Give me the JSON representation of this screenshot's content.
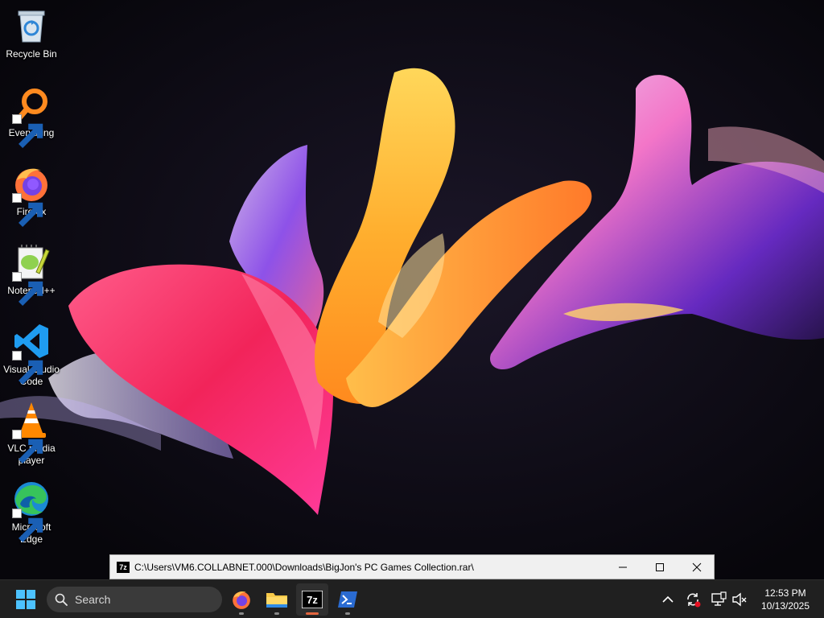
{
  "desktop_icons": [
    {
      "label": "Recycle Bin"
    },
    {
      "label": "Everything"
    },
    {
      "label": "Firefox"
    },
    {
      "label": "Notepad++"
    },
    {
      "label": "Visual Studio Code"
    },
    {
      "label": "VLC media player"
    },
    {
      "label": "Microsoft Edge"
    }
  ],
  "window": {
    "app_icon_text": "7z",
    "title": "C:\\Users\\VM6.COLLABNET.000\\Downloads\\BigJon's PC Games Collection.rar\\"
  },
  "taskbar": {
    "search_label": "Search",
    "pinned": [
      {
        "name": "Firefox",
        "icon": "firefox-icon"
      },
      {
        "name": "File Explorer",
        "icon": "folder-icon"
      },
      {
        "name": "7-Zip File Manager",
        "icon": "sevenzip-icon",
        "text": "7z",
        "active": true
      },
      {
        "name": "PowerShell",
        "icon": "terminal-icon"
      }
    ],
    "tray": [
      "chevron-up-icon",
      "sync-icon",
      "network-icon",
      "volume-muted-icon"
    ],
    "clock": {
      "time": "12:53 PM",
      "date": "10/13/2025"
    }
  },
  "colors": {
    "taskbar_bg": "#202020",
    "window_title_bg": "#f0f0f0",
    "active_indicator": "#e3663f"
  }
}
